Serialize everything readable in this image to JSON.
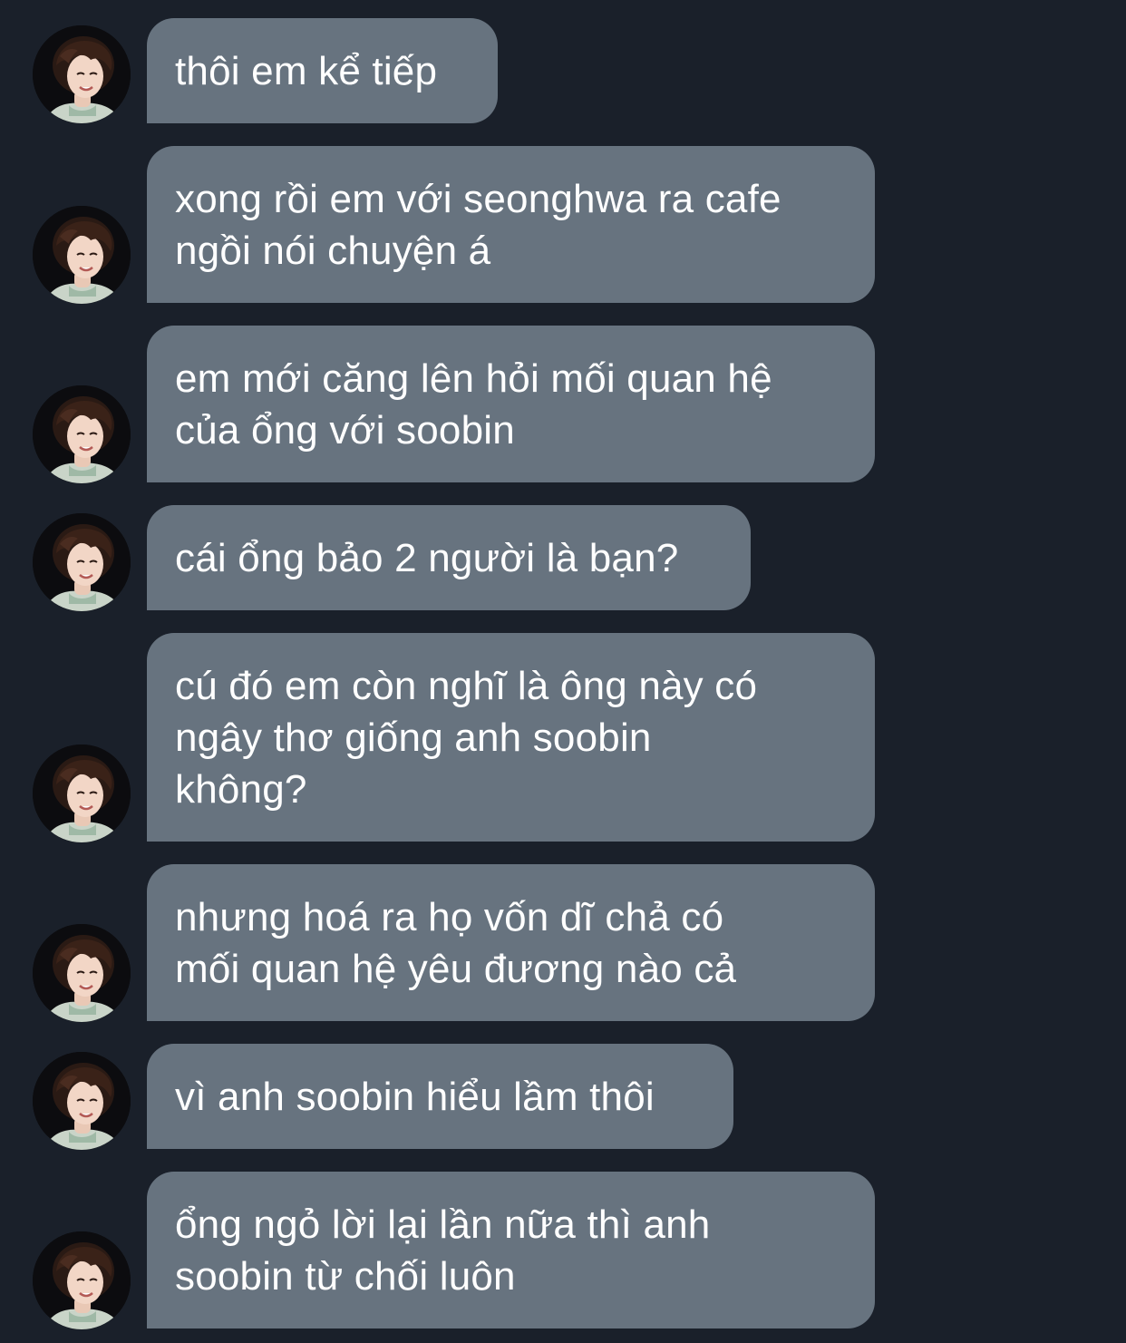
{
  "chat": {
    "colors": {
      "background": "#1a202a",
      "bubble": "#67737f",
      "text": "#ffffff"
    },
    "messages": [
      {
        "avatar_icon": "user-avatar-icon",
        "lines": [
          "thôi em kể tiếp"
        ]
      },
      {
        "avatar_icon": "user-avatar-icon",
        "lines": [
          "xong rồi em với seonghwa ra cafe",
          "ngồi nói chuyện á"
        ]
      },
      {
        "avatar_icon": "user-avatar-icon",
        "lines": [
          "em mới căng lên hỏi mối quan hệ",
          "của ổng với soobin"
        ]
      },
      {
        "avatar_icon": "user-avatar-icon",
        "lines": [
          "cái ổng bảo 2 người là bạn?"
        ]
      },
      {
        "avatar_icon": "user-avatar-icon",
        "lines": [
          "cú đó em còn nghĩ là ông này có",
          "ngây thơ giống anh soobin",
          "không?"
        ]
      },
      {
        "avatar_icon": "user-avatar-icon",
        "lines": [
          "nhưng hoá ra họ vốn dĩ chả có",
          "mối quan hệ yêu đương nào cả"
        ]
      },
      {
        "avatar_icon": "user-avatar-icon",
        "lines": [
          "vì anh soobin hiểu lầm thôi"
        ]
      },
      {
        "avatar_icon": "user-avatar-icon",
        "lines": [
          "ổng ngỏ lời lại lần nữa thì anh",
          "soobin từ chối luôn"
        ]
      }
    ]
  }
}
